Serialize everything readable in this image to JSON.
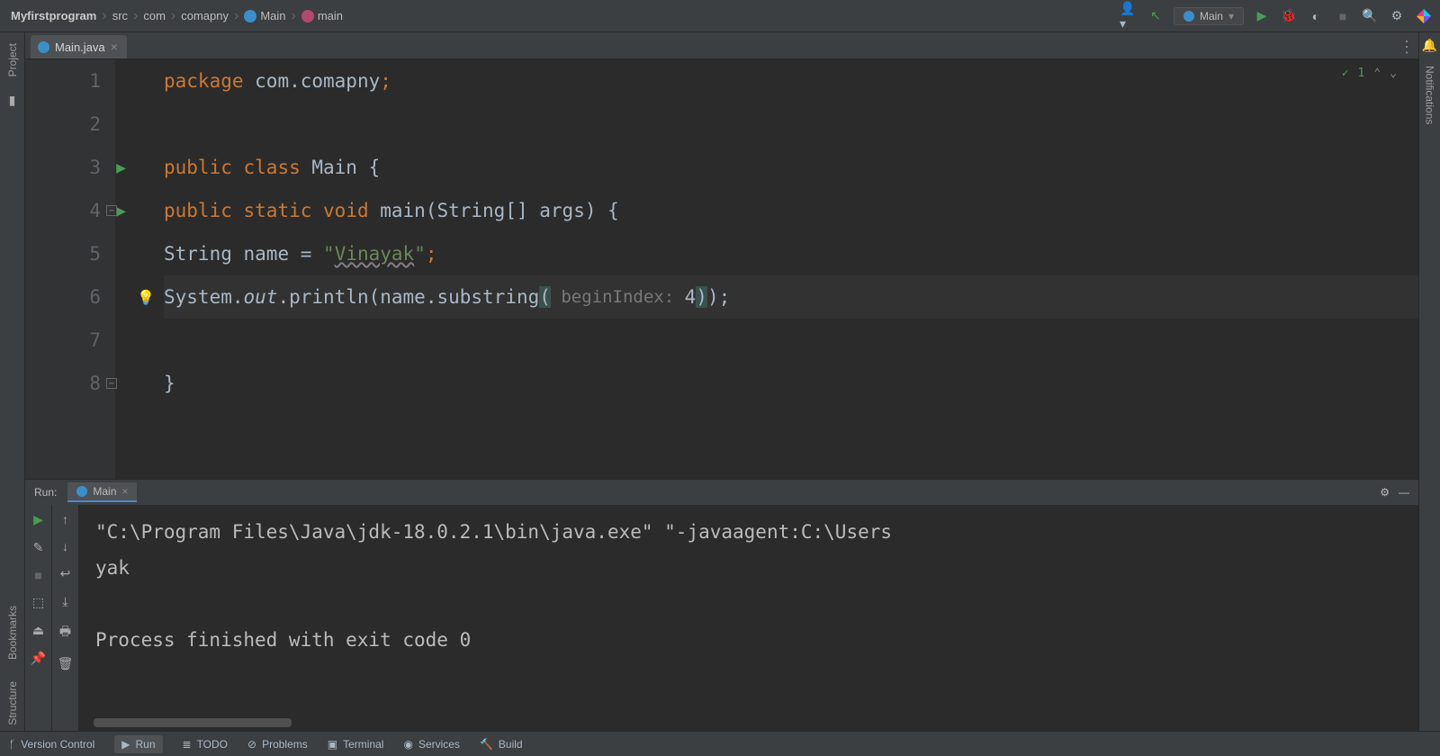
{
  "breadcrumb": {
    "root": "Myfirstprogram",
    "src": "src",
    "pkg1": "com",
    "pkg2": "comapny",
    "class": "Main",
    "method": "main"
  },
  "toolbar": {
    "run_config": "Main"
  },
  "tabs": {
    "file1": "Main.java"
  },
  "editor": {
    "lines": {
      "l1": "1",
      "l2": "2",
      "l3": "3",
      "l4": "4",
      "l5": "5",
      "l6": "6",
      "l7": "7",
      "l8": "8"
    },
    "badge_count": "1",
    "code": {
      "package_kw": "package ",
      "package_name": "com.comapny",
      "semi": ";",
      "public_kw": "public ",
      "class_kw": "class ",
      "class_name": "Main ",
      "lbrace": "{",
      "static_kw": "static ",
      "void_kw": "void ",
      "main_name": "main",
      "main_params": "(String[] args) ",
      "string_type": "String ",
      "var_name": "name ",
      "eq": "= ",
      "quote": "\"",
      "str_val": "Vinayak",
      "system": "System.",
      "out": "out",
      "println": ".println(name.substring",
      "lparen": "(",
      "hint": " beginIndex: ",
      "arg": "4",
      "rparen": ")",
      "rparen2": ");",
      "rbrace": "}"
    }
  },
  "run": {
    "label": "Run:",
    "tab_name": "Main",
    "console_line1": "\"C:\\Program Files\\Java\\jdk-18.0.2.1\\bin\\java.exe\" \"-javaagent:C:\\Users",
    "console_line2": "yak",
    "console_line3": "",
    "console_line4": "Process finished with exit code 0"
  },
  "sidebar": {
    "project": "Project",
    "bookmarks": "Bookmarks",
    "structure": "Structure",
    "notifications": "Notifications"
  },
  "bottombar": {
    "vc": "Version Control",
    "run": "Run",
    "todo": "TODO",
    "problems": "Problems",
    "terminal": "Terminal",
    "services": "Services",
    "build": "Build"
  }
}
